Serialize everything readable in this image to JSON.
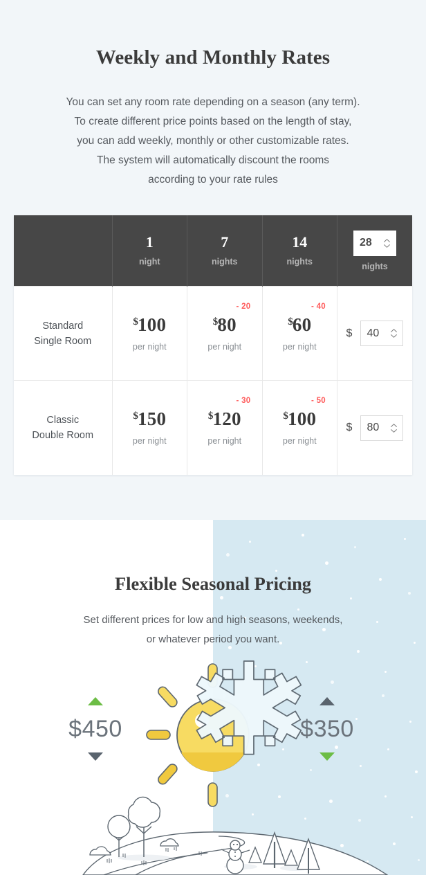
{
  "rates_section": {
    "title": "Weekly and Monthly Rates",
    "subtitle_lines": [
      "You can set any room rate depending on a season (any term).",
      "To create different price points based on the length of stay,",
      "you can add weekly, monthly or other customizable rates.",
      "The system will automatically discount the rooms",
      "according to your rate rules"
    ],
    "table": {
      "header": {
        "corner_label": "",
        "columns": [
          {
            "count": "1",
            "unit": "night"
          },
          {
            "count": "7",
            "unit": "nights"
          },
          {
            "count": "14",
            "unit": "nights"
          }
        ],
        "custom": {
          "value": "28",
          "unit": "nights"
        }
      },
      "rows": [
        {
          "room_line1": "Standard",
          "room_line2": "Single Room",
          "cells": [
            {
              "currency": "$",
              "price": "100",
              "per": "per night",
              "discount": ""
            },
            {
              "currency": "$",
              "price": "80",
              "per": "per night",
              "discount": "- 20"
            },
            {
              "currency": "$",
              "price": "60",
              "per": "per night",
              "discount": "- 40"
            }
          ],
          "custom": {
            "currency": "$",
            "value": "40"
          }
        },
        {
          "room_line1": "Classic",
          "room_line2": "Double Room",
          "cells": [
            {
              "currency": "$",
              "price": "150",
              "per": "per night",
              "discount": ""
            },
            {
              "currency": "$",
              "price": "120",
              "per": "per night",
              "discount": "- 30"
            },
            {
              "currency": "$",
              "price": "100",
              "per": "per night",
              "discount": "- 50"
            }
          ],
          "custom": {
            "currency": "$",
            "value": "80"
          }
        }
      ]
    }
  },
  "seasonal_section": {
    "title": "Flexible Seasonal Pricing",
    "subtitle_lines": [
      "Set different prices for low and high seasons, weekends,",
      "or whatever period you want."
    ],
    "summer": {
      "price": "$450",
      "up_state": "active",
      "down_state": "inactive"
    },
    "winter": {
      "price": "$350",
      "up_state": "inactive",
      "down_state": "active"
    }
  },
  "colors": {
    "page_background": "#f2f6f9",
    "table_header": "#474747",
    "discount_red": "#ff5b5b",
    "winter_background": "#d6e9f2",
    "accent_green": "#6cbd45",
    "arrow_grey": "#5a646e",
    "sun_yellow": "#f7db62",
    "line_art": "#5d6770"
  }
}
